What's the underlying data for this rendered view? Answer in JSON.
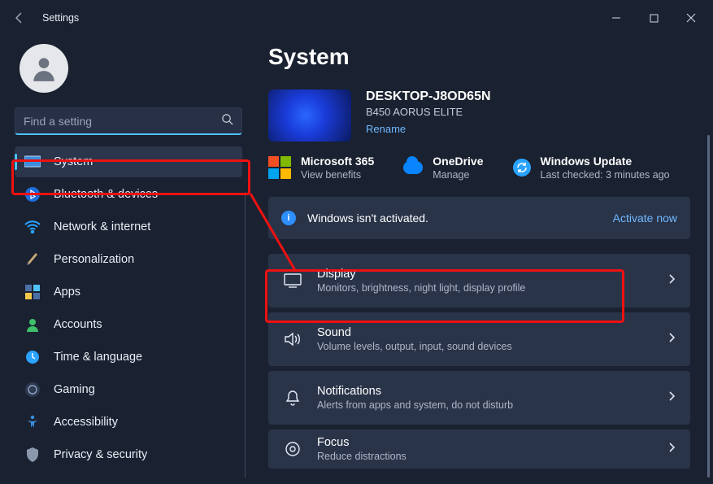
{
  "titlebar": {
    "title": "Settings"
  },
  "search": {
    "placeholder": "Find a setting"
  },
  "sidebar": {
    "items": [
      {
        "label": "System",
        "selected": true
      },
      {
        "label": "Bluetooth & devices"
      },
      {
        "label": "Network & internet"
      },
      {
        "label": "Personalization"
      },
      {
        "label": "Apps"
      },
      {
        "label": "Accounts"
      },
      {
        "label": "Time & language"
      },
      {
        "label": "Gaming"
      },
      {
        "label": "Accessibility"
      },
      {
        "label": "Privacy & security"
      }
    ]
  },
  "page": {
    "title": "System"
  },
  "device": {
    "name": "DESKTOP-J8OD65N",
    "model": "B450 AORUS ELITE",
    "rename": "Rename"
  },
  "promos": {
    "ms365": {
      "title": "Microsoft 365",
      "sub": "View benefits"
    },
    "onedrive": {
      "title": "OneDrive",
      "sub": "Manage"
    },
    "update": {
      "title": "Windows Update",
      "sub": "Last checked: 3 minutes ago"
    }
  },
  "banner": {
    "text": "Windows isn't activated.",
    "action": "Activate now"
  },
  "rows": [
    {
      "title": "Display",
      "sub": "Monitors, brightness, night light, display profile"
    },
    {
      "title": "Sound",
      "sub": "Volume levels, output, input, sound devices"
    },
    {
      "title": "Notifications",
      "sub": "Alerts from apps and system, do not disturb"
    },
    {
      "title": "Focus",
      "sub": "Reduce distractions"
    }
  ]
}
